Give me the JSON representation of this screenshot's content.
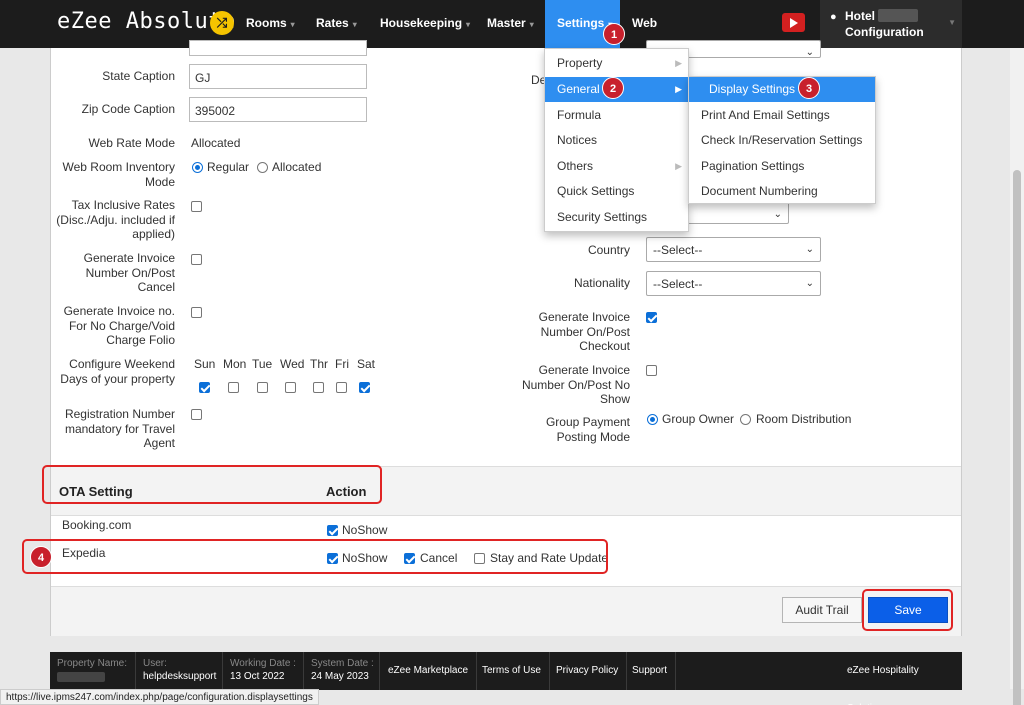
{
  "nav": {
    "brand": "eZee Absolute",
    "brand_icon": "shuffle-icon",
    "items": [
      {
        "label": "Rooms",
        "caret": "▾"
      },
      {
        "label": "Rates",
        "caret": "▾"
      },
      {
        "label": "Housekeeping",
        "caret": "▾"
      },
      {
        "label": "Master",
        "caret": "▾"
      },
      {
        "label": "Settings",
        "caret": "▾"
      },
      {
        "label": "Web",
        "caret": ""
      }
    ],
    "hotel_label": "Hotel",
    "hotel_sub": "Configuration",
    "accent": "#2e8ef0"
  },
  "settings_menu": [
    "Property",
    "General",
    "Formula",
    "Notices",
    "Others",
    "Quick Settings",
    "Security Settings"
  ],
  "general_submenu": [
    "Display Settings",
    "Print And Email Settings",
    "Check In/Reservation Settings",
    "Pagination Settings",
    "Document Numbering"
  ],
  "form": {
    "state_caption": {
      "label": "State Caption",
      "value": "GJ"
    },
    "zip_caption": {
      "label": "Zip Code Caption",
      "value": "395002"
    },
    "web_rate_mode": {
      "label": "Web Rate Mode",
      "value": "Allocated"
    },
    "web_room_inventory": {
      "label": "Web Room Inventory Mode",
      "options": [
        "Regular",
        "Allocated"
      ],
      "selected": "Regular"
    },
    "tax_inclusive": {
      "label": "Tax Inclusive Rates (Disc./Adju. included if applied)",
      "checked": false
    },
    "gen_invoice_cancel": {
      "label": "Generate Invoice Number On/Post Cancel",
      "checked": false
    },
    "gen_invoice_nocharge": {
      "label": "Generate Invoice no. For No Charge/Void Charge Folio",
      "checked": false
    },
    "weekend": {
      "label": "Configure Weekend Days of your property",
      "days": [
        "Sun",
        "Mon",
        "Tue",
        "Wed",
        "Thr",
        "Fri",
        "Sat"
      ],
      "checked": [
        true,
        false,
        false,
        false,
        false,
        false,
        true
      ]
    },
    "reg_number": {
      "label": "Registration Number mandatory for Travel Agent",
      "checked": false
    },
    "right_partial_label": "De",
    "country": {
      "label": "Country",
      "value": "--Select--"
    },
    "nationality": {
      "label": "Nationality",
      "value": "--Select--"
    },
    "gen_invoice_checkout": {
      "label": "Generate Invoice Number On/Post Checkout",
      "checked": true
    },
    "gen_invoice_noshow": {
      "label": "Generate Invoice Number On/Post No Show",
      "checked": false
    },
    "group_payment": {
      "label": "Group Payment Posting Mode",
      "options": [
        "Group Owner",
        "Room Distribution"
      ],
      "selected": "Group Owner"
    }
  },
  "ota": {
    "header_setting": "OTA Setting",
    "header_action": "Action",
    "rows": [
      {
        "name": "Booking.com",
        "actions": [
          {
            "label": "NoShow",
            "checked": true
          }
        ]
      },
      {
        "name": "Expedia",
        "actions": [
          {
            "label": "NoShow",
            "checked": true
          },
          {
            "label": "Cancel",
            "checked": true
          },
          {
            "label": "Stay and Rate Update",
            "checked": false
          }
        ]
      }
    ]
  },
  "buttons": {
    "audit": "Audit Trail",
    "save": "Save"
  },
  "badges": [
    "1",
    "2",
    "3",
    "4"
  ],
  "footer": {
    "property_name_label": "Property Name:",
    "user_label": "User:",
    "user_value": "helpdesksupport",
    "working_date_label": "Working Date :",
    "working_date_value": "13 Oct 2022",
    "system_date_label": "System Date :",
    "system_date_value": "24 May 2023",
    "links": [
      "eZee Marketplace",
      "Terms of Use",
      "Privacy Policy",
      "Support"
    ],
    "company": "eZee Hospitality Solution"
  },
  "status_url": "https://live.ipms247.com/index.php/page/configuration.displaysettings",
  "colors": {
    "annotation": "#e02424",
    "save": "#0b5fe8",
    "nav_bg": "#1c1c1c"
  }
}
